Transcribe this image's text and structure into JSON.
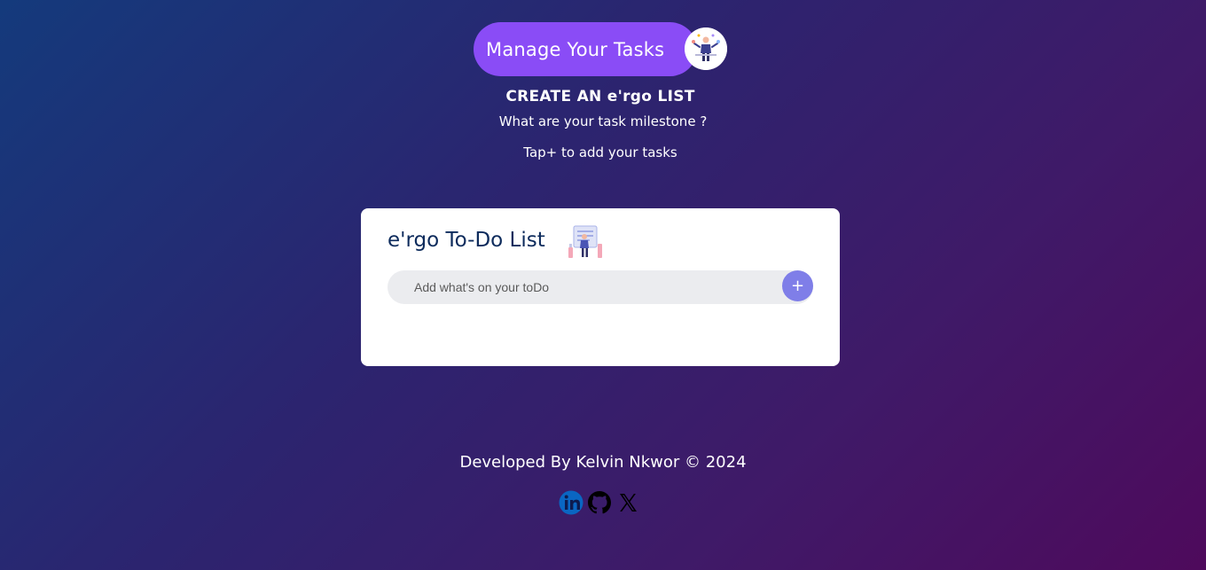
{
  "header": {
    "title": "Manage Your Tasks"
  },
  "intro": {
    "heading": "CREATE AN e'rgo LIST",
    "question": "What are your task milestone ?",
    "hint": "Tap+ to add your tasks"
  },
  "todo_card": {
    "title": "e'rgo To-Do List",
    "input_value": "",
    "input_placeholder": "Add what's on your toDo",
    "add_button_label": "+"
  },
  "footer": {
    "credit": "Developed By Kelvin Nkwor © 2024",
    "socials": [
      {
        "icon": "linkedin-icon"
      },
      {
        "icon": "github-icon"
      },
      {
        "icon": "x-icon"
      }
    ]
  },
  "colors": {
    "accent": "#8a4cf6",
    "add_button": "#7f7ee8",
    "card_title": "#0d2b5c",
    "linkedin": "#0a66c2"
  }
}
